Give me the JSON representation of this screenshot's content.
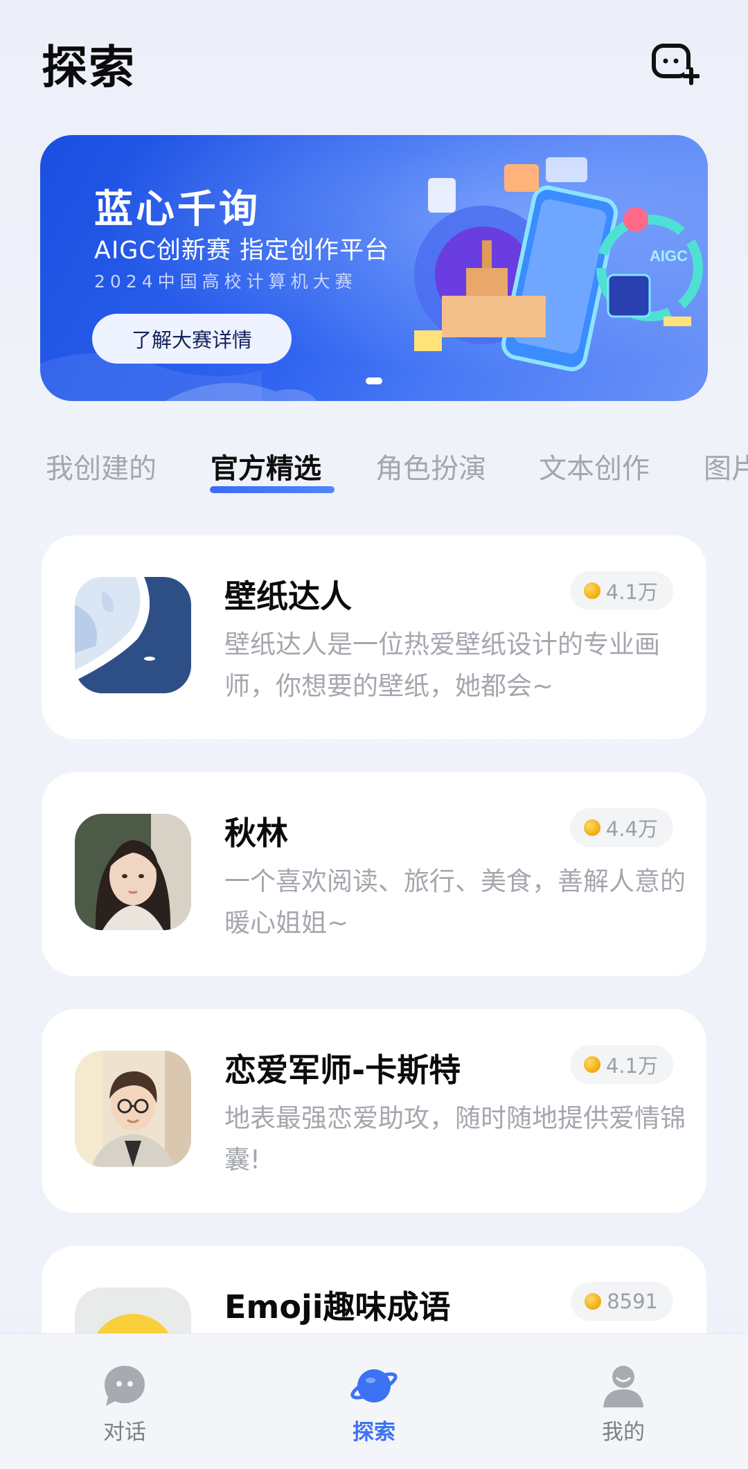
{
  "header": {
    "title": "探索",
    "new_chat_icon": "new-chat-plus-icon"
  },
  "banner": {
    "title": "蓝心千询",
    "subtitle": "AIGC创新赛 指定创作平台",
    "subtitle2": "2024中国高校计算机大赛",
    "cta": "了解大赛详情",
    "art_text": "AIGC"
  },
  "tabs": [
    {
      "label": "我创建的",
      "active": false
    },
    {
      "label": "官方精选",
      "active": true
    },
    {
      "label": "角色扮演",
      "active": false
    },
    {
      "label": "文本创作",
      "active": false
    },
    {
      "label": "图片",
      "active": false
    }
  ],
  "cards": [
    {
      "name": "壁纸达人",
      "desc": "壁纸达人是一位热爱壁纸设计的专业画师，你想要的壁纸，她都会~",
      "count": "4.1万",
      "avatar": "wallpaper-avatar"
    },
    {
      "name": "秋林",
      "desc": "一个喜欢阅读、旅行、美食，善解人意的暖心姐姐~",
      "count": "4.4万",
      "avatar": "woman-avatar"
    },
    {
      "name": "恋爱军师-卡斯特",
      "desc": "地表最强恋爱助攻，随时随地提供爱情锦囊!",
      "count": "4.1万",
      "avatar": "man-avatar"
    },
    {
      "name": "Emoji趣味成语",
      "desc": "",
      "count": "8591",
      "avatar": "emoji-avatar"
    }
  ],
  "nav": [
    {
      "label": "对话",
      "icon": "chat-bubble-icon",
      "active": false
    },
    {
      "label": "探索",
      "icon": "planet-icon",
      "active": true
    },
    {
      "label": "我的",
      "icon": "user-icon",
      "active": false
    }
  ],
  "colors": {
    "accent": "#3c72f3",
    "banner_blue": "#2f63f0",
    "coin": "#f2a90a"
  }
}
